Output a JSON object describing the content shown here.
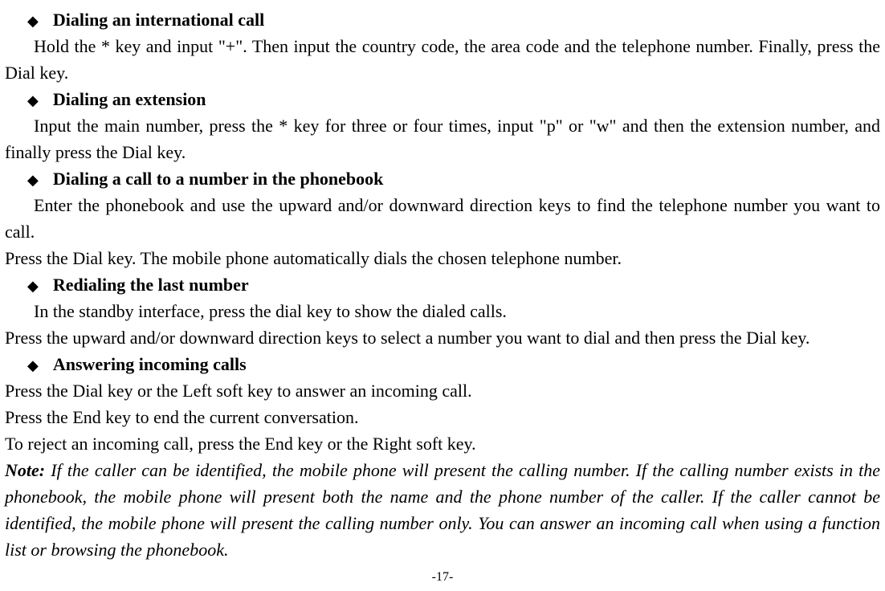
{
  "sections": {
    "s1": {
      "title": "Dialing an international call",
      "body": "Hold the * key and input \"+\". Then input the country code, the area code and the telephone number. Finally, press the Dial key."
    },
    "s2": {
      "title": "Dialing an extension",
      "body": "Input the main number, press the * key for three or four times, input \"p\" or \"w\" and then the extension number, and finally press the Dial key."
    },
    "s3": {
      "title": "Dialing a call to a number in the phonebook",
      "body1": "Enter the phonebook and use the upward and/or downward direction keys to find the telephone number you want to call.",
      "body2": "Press the Dial key. The mobile phone automatically dials the chosen telephone number."
    },
    "s4": {
      "title": "Redialing the last number",
      "body1": "In the standby interface, press the dial key to show the dialed calls.",
      "body2": "Press the upward and/or downward direction keys to select a number you want to dial and then press the Dial key."
    },
    "s5": {
      "title": "Answering incoming calls",
      "body1": "Press the Dial key or the Left soft key to answer an incoming call.",
      "body2": "Press the End key to end the current conversation.",
      "body3": "To reject an incoming call, press the End key or the Right soft key."
    }
  },
  "note": {
    "label": "Note:",
    "text": " If the caller can be identified, the mobile phone will present the calling number. If the calling number exists in the phonebook, the mobile phone will present both the name and the phone number of the caller. If the caller cannot be identified, the mobile phone will present the calling number only. You can answer an incoming call when using a function list or browsing the phonebook."
  },
  "pageNumber": "-17-",
  "bullet": "◆"
}
